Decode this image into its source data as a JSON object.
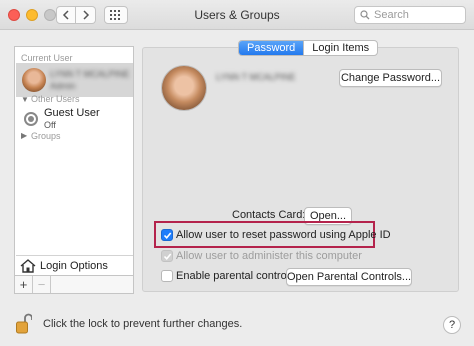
{
  "window": {
    "title": "Users & Groups",
    "search_placeholder": "Search"
  },
  "icons": {
    "back": "chevron-left-icon",
    "forward": "chevron-right-icon",
    "show_all": "grid-icon",
    "search": "search-icon",
    "guest": "user-icon",
    "login_options": "house-icon",
    "lock": "open-lock-icon",
    "checkmark": "checkmark-icon"
  },
  "sidebar": {
    "current_user_header": "Current User",
    "current_user_name": "LYNN T MCALPINE",
    "current_user_role": "Admin",
    "other_users_header": "Other Users",
    "guest_name": "Guest User",
    "guest_status": "Off",
    "groups_header": "Groups",
    "login_options_label": "Login Options",
    "add_label": "+",
    "remove_label": "−"
  },
  "tabs": [
    {
      "label": "Password",
      "active": true
    },
    {
      "label": "Login Items",
      "active": false
    }
  ],
  "user_panel": {
    "full_name": "LYNN T MCALPINE",
    "change_password_label": "Change Password...",
    "contacts_card_label": "Contacts Card:",
    "open_label": "Open...",
    "allow_reset_label": "Allow user to reset password using Apple ID",
    "allow_reset_checked": true,
    "allow_admin_label": "Allow user to administer this computer",
    "allow_admin_checked": true,
    "allow_admin_enabled": false,
    "parental_label": "Enable parental controls",
    "parental_checked": false,
    "open_parental_label": "Open Parental Controls..."
  },
  "footer": {
    "lock_text": "Click the lock to prevent further changes.",
    "help_label": "?"
  },
  "colors": {
    "accent": "#2379ee",
    "highlight_border": "#b4234c"
  }
}
